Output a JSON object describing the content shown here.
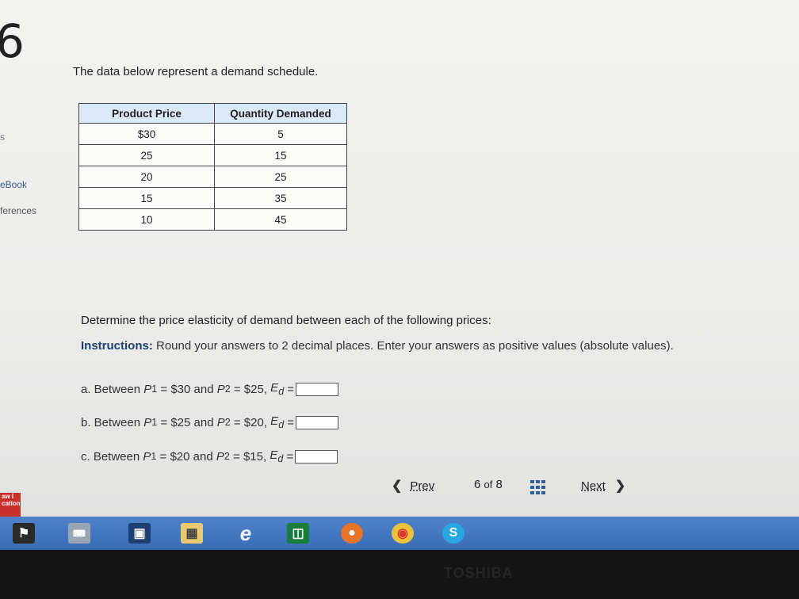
{
  "question_number": "6",
  "sidebar": {
    "s_label": "s",
    "ebook": "eBook",
    "references": "ferences",
    "logo": "aw l cation"
  },
  "prompt": "The data below represent a demand schedule.",
  "table": {
    "headers": [
      "Product Price",
      "Quantity Demanded"
    ],
    "rows": [
      [
        "$30",
        "5"
      ],
      [
        "25",
        "15"
      ],
      [
        "20",
        "25"
      ],
      [
        "15",
        "35"
      ],
      [
        "10",
        "45"
      ]
    ]
  },
  "task": "Determine the price elasticity of demand between each of the following prices:",
  "instructions": {
    "label": "Instructions:",
    "text": " Round your answers to 2 decimal places. Enter your answers as positive values (absolute values)."
  },
  "questions": [
    {
      "prefix": "a. Between ",
      "p1": "$30",
      "p2": "$25",
      "answer": ""
    },
    {
      "prefix": "b. Between ",
      "p1": "$25",
      "p2": "$20",
      "answer": ""
    },
    {
      "prefix": "c. Between ",
      "p1": "$20",
      "p2": "$15",
      "answer": ""
    }
  ],
  "nav": {
    "prev": "Prev",
    "page": "6",
    "of": "of",
    "total": "8",
    "next": "Next"
  },
  "taskbar_icons": [
    "flag-icon",
    "keyboard-icon",
    "monitor-icon",
    "folder-icon",
    "ie-icon",
    "store-icon",
    "firefox-icon",
    "chrome-icon",
    "skype-icon"
  ],
  "brand": "TOSHIBA",
  "colors": {
    "taskbar": "#3a6cb6",
    "table_header": "#dbe8f5",
    "link": "#1f3f6c"
  }
}
